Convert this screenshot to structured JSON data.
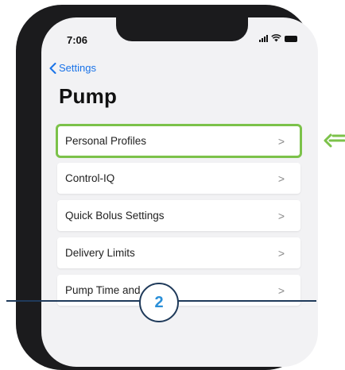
{
  "status_bar": {
    "time": "7:06"
  },
  "nav": {
    "back_label": "Settings"
  },
  "page": {
    "title": "Pump"
  },
  "menu": {
    "items": [
      {
        "label": "Personal Profiles",
        "highlighted": true
      },
      {
        "label": "Control-IQ"
      },
      {
        "label": "Quick Bolus Settings"
      },
      {
        "label": "Delivery Limits"
      },
      {
        "label": "Pump Time and"
      }
    ]
  },
  "callout": {
    "step": "2"
  },
  "colors": {
    "highlight": "#7cc24a",
    "link": "#1a73e8",
    "badge_text": "#2a8fd8",
    "line": "#1f3a5a"
  }
}
